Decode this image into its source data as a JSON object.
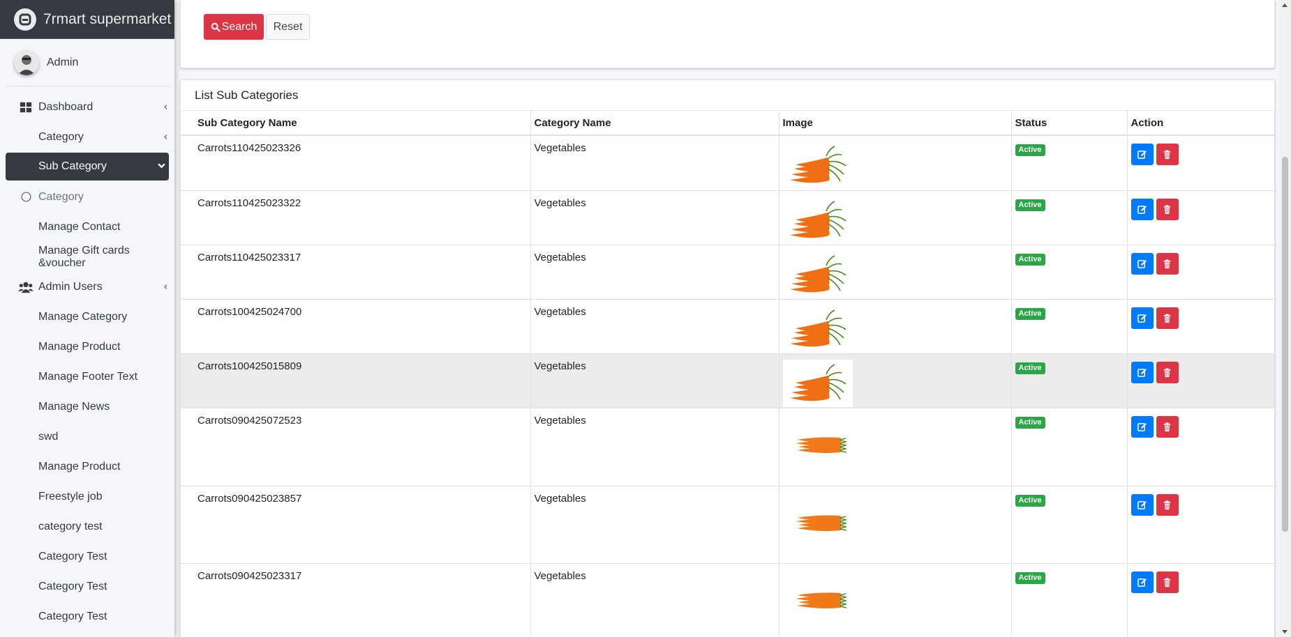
{
  "brand": {
    "title": "7rmart supermarket"
  },
  "user": {
    "name": "Admin"
  },
  "sidebar": {
    "items": [
      {
        "label": "Dashboard",
        "icon": "dashboard-icon",
        "caret": true
      },
      {
        "label": "Category",
        "caret": true
      },
      {
        "label": "Sub Category",
        "active": true
      },
      {
        "label": "Category",
        "icon": "circle-icon",
        "muted": true
      },
      {
        "label": "Manage Contact"
      },
      {
        "label": "Manage Gift cards &voucher"
      },
      {
        "label": "Admin Users",
        "icon": "users-icon",
        "caret": true
      },
      {
        "label": "Manage Category"
      },
      {
        "label": "Manage Product"
      },
      {
        "label": "Manage Footer Text"
      },
      {
        "label": "Manage News"
      },
      {
        "label": "swd"
      },
      {
        "label": "Manage Product"
      },
      {
        "label": "Freestyle job"
      },
      {
        "label": "category test"
      },
      {
        "label": "Category Test"
      },
      {
        "label": "Category Test"
      },
      {
        "label": "Category Test"
      }
    ]
  },
  "search_card": {
    "search_label": "Search",
    "reset_label": "Reset"
  },
  "list": {
    "title": "List Sub Categories",
    "columns": [
      "Sub Category Name",
      "Category Name",
      "Image",
      "Status",
      "Action"
    ],
    "rows": [
      {
        "name": "Carrots110425023326",
        "category": "Vegetables",
        "status": "Active",
        "image": "carrots-bunch"
      },
      {
        "name": "Carrots110425023322",
        "category": "Vegetables",
        "status": "Active",
        "image": "carrots-bunch"
      },
      {
        "name": "Carrots110425023317",
        "category": "Vegetables",
        "status": "Active",
        "image": "carrots-bunch"
      },
      {
        "name": "Carrots100425024700",
        "category": "Vegetables",
        "status": "Active",
        "image": "carrots-bunch"
      },
      {
        "name": "Carrots100425015809",
        "category": "Vegetables",
        "status": "Active",
        "image": "carrots-bunch",
        "highlighted": true
      },
      {
        "name": "Carrots090425072523",
        "category": "Vegetables",
        "status": "Active",
        "image": "carrots-flat"
      },
      {
        "name": "Carrots090425023857",
        "category": "Vegetables",
        "status": "Active",
        "image": "carrots-flat"
      },
      {
        "name": "Carrots090425023317",
        "category": "Vegetables",
        "status": "Active",
        "image": "carrots-flat"
      }
    ]
  },
  "colors": {
    "sidebar_active": "#343a40",
    "search_button": "#dc3545",
    "edit_button": "#007bff",
    "delete_button": "#dc3545",
    "status_active": "#28a745"
  }
}
